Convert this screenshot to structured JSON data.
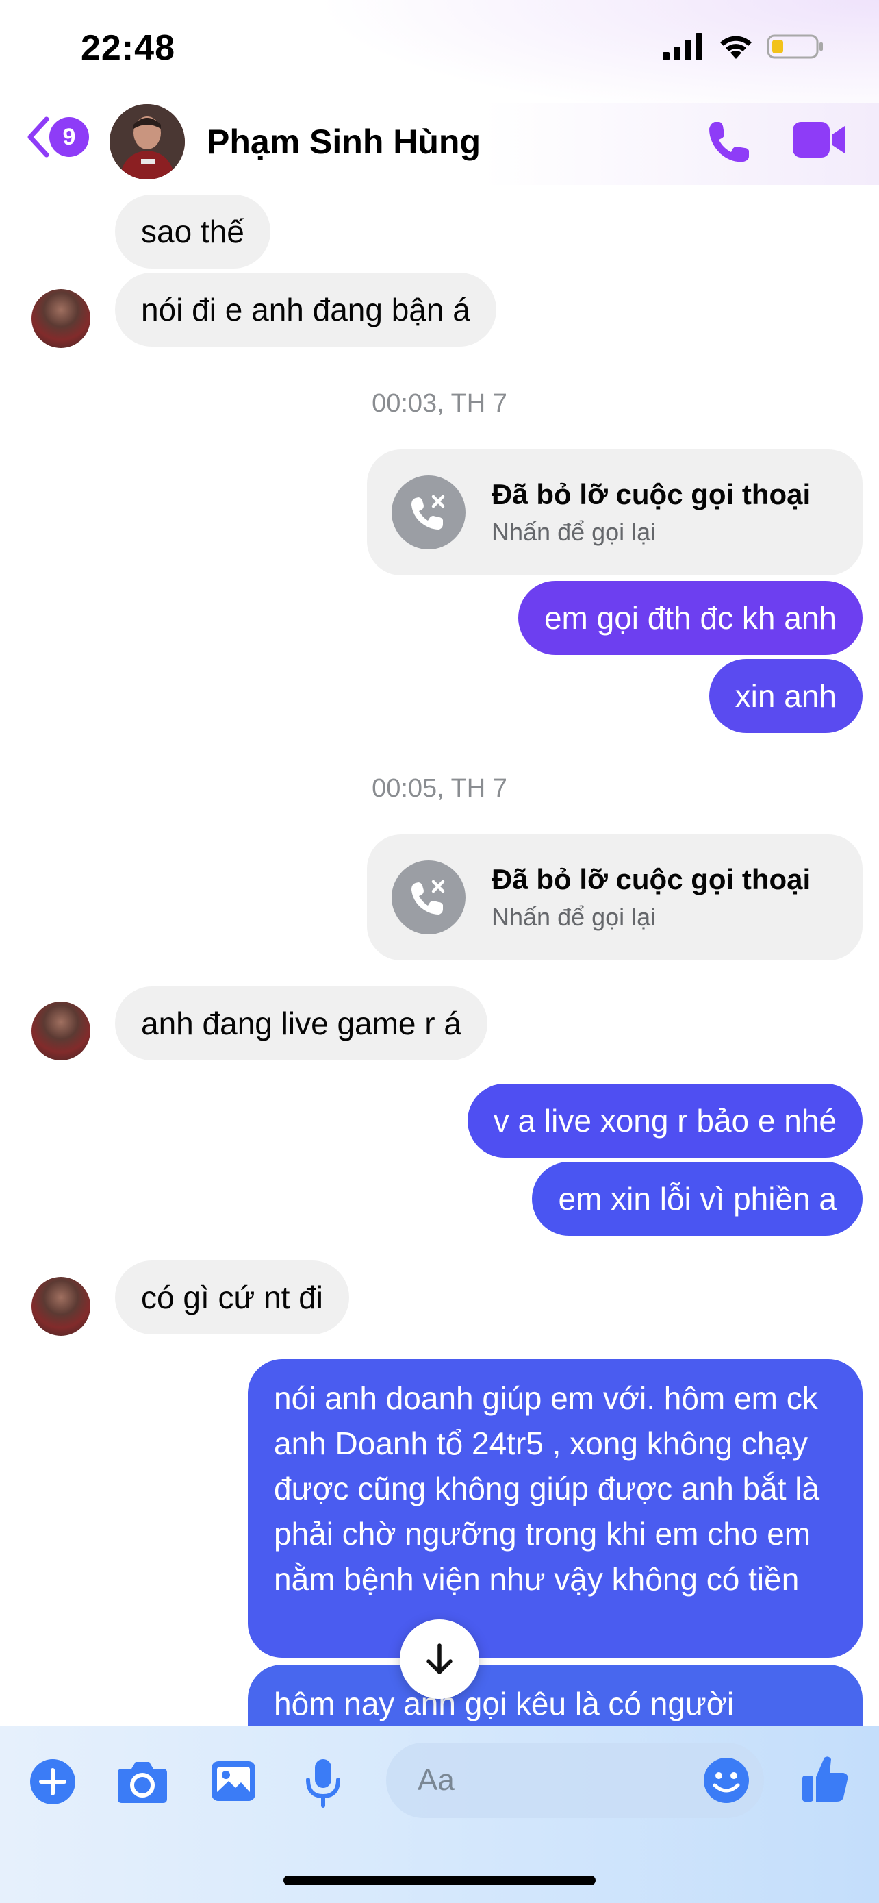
{
  "status_bar": {
    "time": "22:48"
  },
  "header": {
    "unread_count": "9",
    "contact_name": "Phạm Sinh Hùng"
  },
  "messages": {
    "m1": "sao thế",
    "m2": "nói đi e anh đang bận á",
    "ts1": "00:03, TH 7",
    "call1_title": "Đã bỏ lỡ cuộc gọi thoại",
    "call1_sub": "Nhấn để gọi lại",
    "m3": "em gọi đth đc kh anh",
    "m4": "xin anh",
    "ts2": "00:05, TH 7",
    "call2_title": "Đã bỏ lỡ cuộc gọi thoại",
    "call2_sub": "Nhấn để gọi lại",
    "m5": "anh đang live game r á",
    "m6": "v a live xong r bảo e nhé",
    "m7": "em xin lỗi vì phiền a",
    "m8": "có gì cứ nt đi",
    "m9": "nói anh doanh giúp em với. hôm em ck anh Doanh tổ 24tr5 , xong không chạy được cũng không giúp được anh bắt là phải chờ ngưỡng trong khi em cho em nằm bệnh viện như vậy không có tiền",
    "m10": "hôm nay anh gọi kêu là có người"
  },
  "composer": {
    "placeholder": "Aa"
  },
  "colors": {
    "accent": "#8e3cf7",
    "outgoing_bubble": "#4a55f2",
    "incoming_bubble": "#f0f0f0",
    "composer_icon": "#3b7cf6"
  },
  "icons": {
    "back": "chevron-left-icon",
    "call": "phone-icon",
    "video": "video-camera-icon",
    "missed_call": "missed-call-icon",
    "scroll_down": "arrow-down-icon",
    "add": "plus-circle-icon",
    "camera": "camera-icon",
    "gallery": "image-icon",
    "mic": "microphone-icon",
    "emoji": "emoji-icon",
    "like": "thumbs-up-icon"
  }
}
